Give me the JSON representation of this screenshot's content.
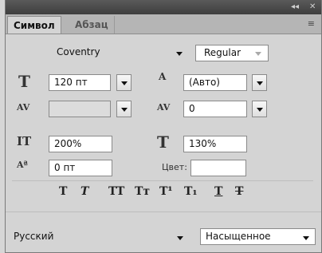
{
  "window": {
    "collapse": "◂◂",
    "close": "✕"
  },
  "tabs": [
    {
      "label": "Символ"
    },
    {
      "label": "Абзац"
    }
  ],
  "menu_icon": "≡",
  "font": {
    "family": "Coventry",
    "style": "Regular"
  },
  "size": {
    "value": "120 пт"
  },
  "leading": {
    "value": "(Авто)"
  },
  "kerning": {
    "value": ""
  },
  "tracking": {
    "value": "0"
  },
  "vertical_scale": {
    "value": "200%"
  },
  "horizontal_scale": {
    "value": "130%"
  },
  "baseline_shift": {
    "value": "0 пт"
  },
  "color": {
    "label": "Цвет:",
    "swatch": "#ffffff"
  },
  "icons": {
    "size": "T",
    "leading": "A",
    "kerning": "AV",
    "tracking": "AV",
    "vscale": "IT",
    "hscale": "T",
    "baseline": "Aª"
  },
  "style_buttons": [
    {
      "name": "faux-bold",
      "glyph": "T"
    },
    {
      "name": "faux-italic",
      "glyph": "T"
    },
    {
      "name": "all-caps",
      "glyph": "TT"
    },
    {
      "name": "small-caps",
      "glyph": "Tт"
    },
    {
      "name": "superscript",
      "glyph": "T¹"
    },
    {
      "name": "subscript",
      "glyph": "T₁"
    },
    {
      "name": "underline",
      "glyph": "T"
    },
    {
      "name": "strikethrough",
      "glyph": "T"
    }
  ],
  "language": {
    "value": "Русский"
  },
  "antialias": {
    "icon": "ªa",
    "value": "Насыщенное"
  }
}
